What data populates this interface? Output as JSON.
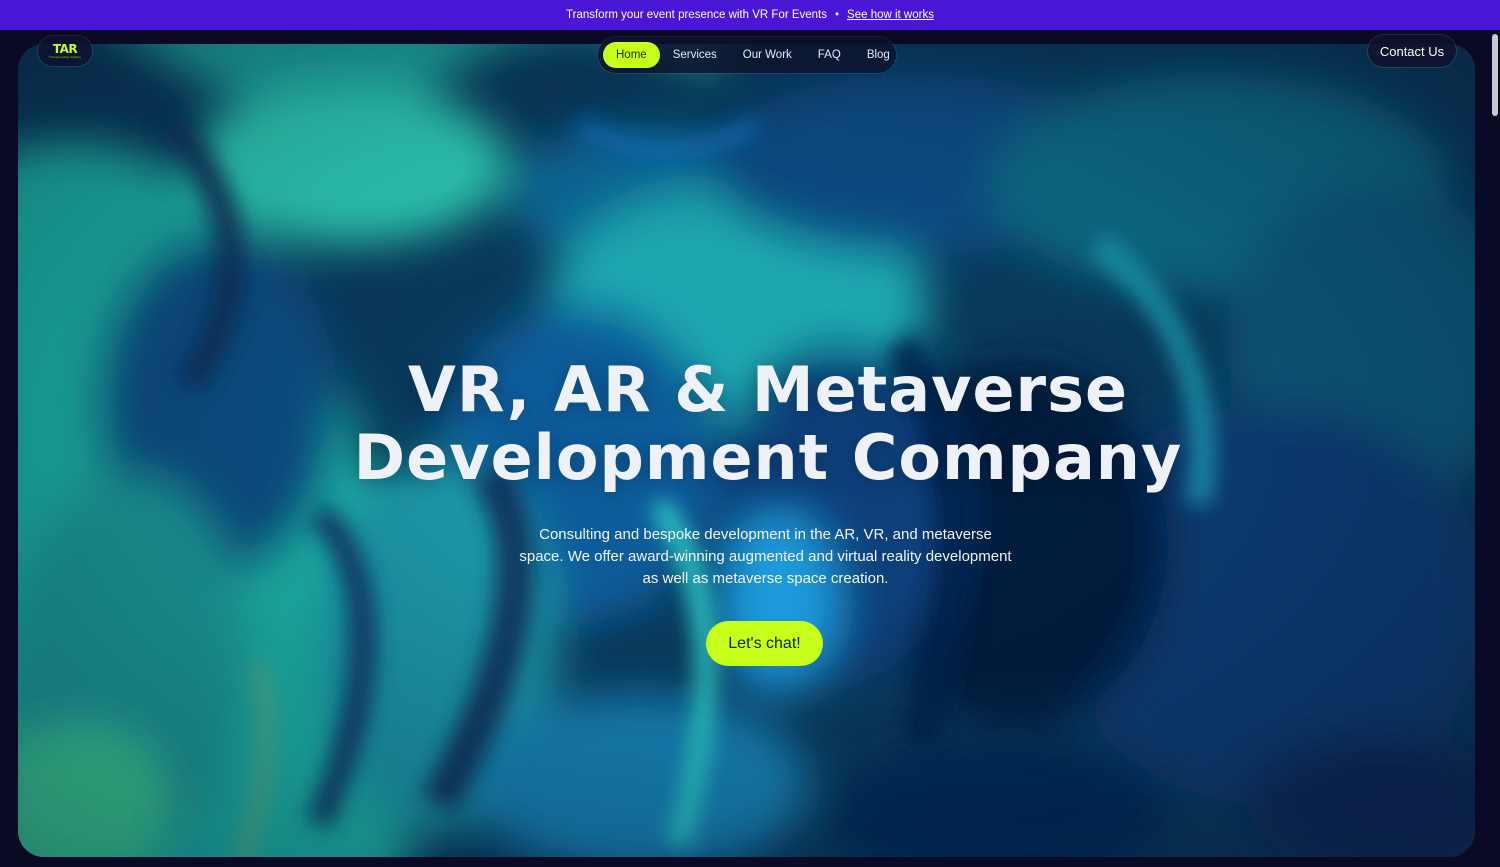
{
  "announcement": {
    "text": "Transform your event presence with VR For Events",
    "separator": "•",
    "link": "See how it works"
  },
  "logo": {
    "mark": "TAR",
    "tagline": "Transcending Reality"
  },
  "nav": {
    "items": [
      {
        "label": "Home",
        "active": true
      },
      {
        "label": "Services",
        "active": false
      },
      {
        "label": "Our Work",
        "active": false
      },
      {
        "label": "FAQ",
        "active": false
      },
      {
        "label": "Blog",
        "active": false
      }
    ]
  },
  "contact_button": "Contact Us",
  "hero": {
    "headline_line1": "VR, AR & Metaverse",
    "headline_line2": "Development Company",
    "subtitle": "Consulting and bespoke development in the AR, VR, and metaverse space. We offer award-winning augmented and virtual reality development as well as metaverse space creation.",
    "cta": "Let's chat!"
  },
  "colors": {
    "announcement_bg": "#4a16d6",
    "accent": "#c6ff1a",
    "page_bg": "#0a0a24"
  }
}
